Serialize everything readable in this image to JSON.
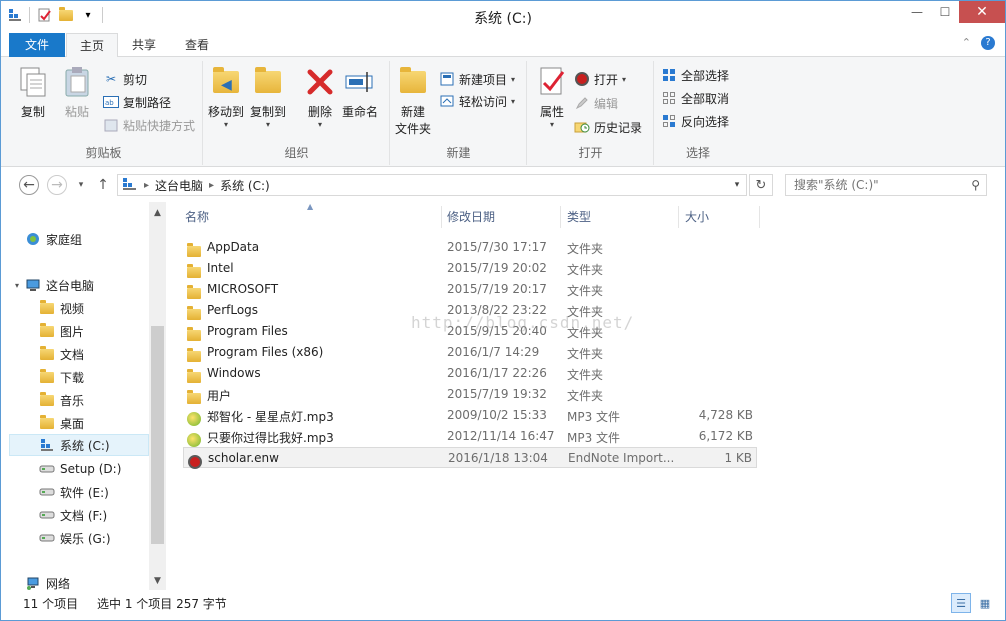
{
  "window": {
    "title": "系统 (C:)"
  },
  "ribbon_tabs": {
    "file": "文件",
    "home": "主页",
    "share": "共享",
    "view": "查看"
  },
  "ribbon": {
    "clipboard": {
      "label": "剪贴板",
      "copy": "复制",
      "paste": "粘贴",
      "cut": "剪切",
      "copy_path": "复制路径",
      "paste_shortcut": "粘贴快捷方式"
    },
    "organize": {
      "label": "组织",
      "move_to": "移动到",
      "copy_to": "复制到",
      "delete": "删除",
      "rename": "重命名"
    },
    "new": {
      "label": "新建",
      "new_folder": "新建\n文件夹",
      "new_folder_l1": "新建",
      "new_folder_l2": "文件夹",
      "new_item": "新建项目",
      "easy_access": "轻松访问"
    },
    "open": {
      "label": "打开",
      "properties": "属性",
      "open": "打开",
      "edit": "编辑",
      "history": "历史记录"
    },
    "select": {
      "label": "选择",
      "select_all": "全部选择",
      "select_none": "全部取消",
      "invert": "反向选择"
    }
  },
  "address": {
    "crumbs": [
      "这台电脑",
      "系统 (C:)"
    ]
  },
  "search": {
    "placeholder": "搜索\"系统 (C:)\""
  },
  "nav_pane": {
    "homegroup": "家庭组",
    "this_pc": "这台电脑",
    "items": [
      "视频",
      "图片",
      "文档",
      "下载",
      "音乐",
      "桌面",
      "系统 (C:)",
      "Setup (D:)",
      "软件 (E:)",
      "文档 (F:)",
      "娱乐 (G:)"
    ],
    "network": "网络"
  },
  "columns": {
    "name": "名称",
    "date": "修改日期",
    "type": "类型",
    "size": "大小"
  },
  "files": [
    {
      "name": "AppData",
      "date": "2015/7/30 17:17",
      "type": "文件夹",
      "size": "",
      "kind": "folder"
    },
    {
      "name": "Intel",
      "date": "2015/7/19 20:02",
      "type": "文件夹",
      "size": "",
      "kind": "folder"
    },
    {
      "name": "MICROSOFT",
      "date": "2015/7/19 20:17",
      "type": "文件夹",
      "size": "",
      "kind": "folder"
    },
    {
      "name": "PerfLogs",
      "date": "2013/8/22 23:22",
      "type": "文件夹",
      "size": "",
      "kind": "folder"
    },
    {
      "name": "Program Files",
      "date": "2015/9/15 20:40",
      "type": "文件夹",
      "size": "",
      "kind": "folder"
    },
    {
      "name": "Program Files (x86)",
      "date": "2016/1/7 14:29",
      "type": "文件夹",
      "size": "",
      "kind": "folder"
    },
    {
      "name": "Windows",
      "date": "2016/1/17 22:26",
      "type": "文件夹",
      "size": "",
      "kind": "folder"
    },
    {
      "name": "用户",
      "date": "2015/7/19 19:32",
      "type": "文件夹",
      "size": "",
      "kind": "folder"
    },
    {
      "name": "郑智化 - 星星点灯.mp3",
      "date": "2009/10/2 15:33",
      "type": "MP3 文件",
      "size": "4,728 KB",
      "kind": "mp3"
    },
    {
      "name": "只要你过得比我好.mp3",
      "date": "2012/11/14 16:47",
      "type": "MP3 文件",
      "size": "6,172 KB",
      "kind": "mp3"
    },
    {
      "name": "scholar.enw",
      "date": "2016/1/18 13:04",
      "type": "EndNote Import...",
      "size": "1 KB",
      "kind": "enw"
    }
  ],
  "watermark": "http://blog.csdn.net/",
  "status": {
    "count": "11 个项目",
    "selection": "选中 1 个项目  257 字节"
  }
}
